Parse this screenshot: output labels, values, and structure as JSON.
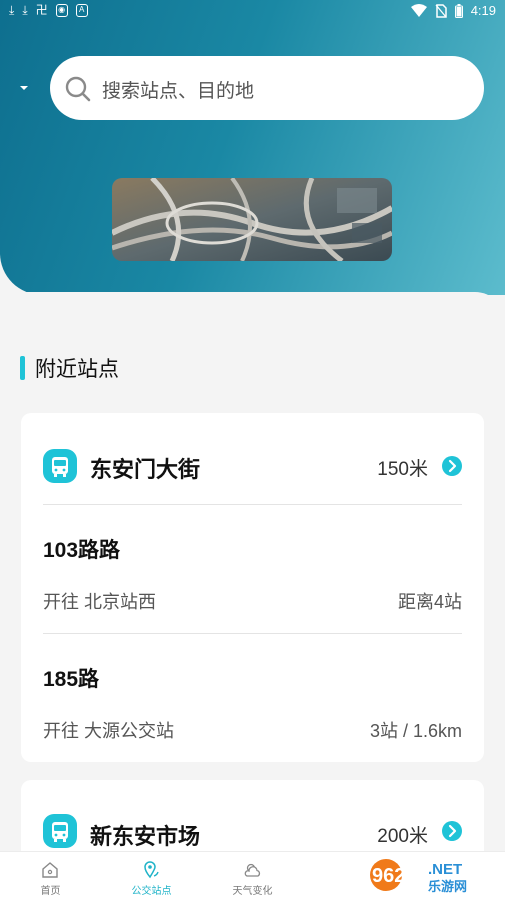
{
  "status_bar": {
    "time": "4:19",
    "left_icons": [
      "download-icon",
      "download-icon",
      "sim-icon",
      "vpn-icon",
      "a-icon"
    ],
    "right_icons": [
      "wifi-icon",
      "no-sim-icon",
      "battery-icon"
    ]
  },
  "search": {
    "placeholder": "搜索站点、目的地"
  },
  "section": {
    "title": "附近站点"
  },
  "stops": [
    {
      "name": "东安门大街",
      "distance": "150米",
      "routes": [
        {
          "name": "103路路",
          "direction": "开往 北京站西",
          "eta": "距离4站"
        },
        {
          "name": "185路",
          "direction": "开往 大源公交站",
          "eta": "3站 / 1.6km"
        }
      ]
    },
    {
      "name": "新东安市场",
      "distance": "200米",
      "routes": []
    }
  ],
  "tabs": [
    {
      "label": "首页",
      "icon": "home-icon",
      "active": false
    },
    {
      "label": "公交站点",
      "icon": "location-pin-icon",
      "active": true
    },
    {
      "label": "天气变化",
      "icon": "weather-icon",
      "active": false
    },
    {
      "label": "",
      "icon": "",
      "active": false
    },
    {
      "label": "",
      "icon": "",
      "active": false
    }
  ],
  "colors": {
    "accent": "#1fc3d7",
    "header_start": "#0e6f8f",
    "header_end": "#5cbccd",
    "background": "#f4f4f4"
  },
  "watermark": {
    "text": "962.NET",
    "sub": "乐游网"
  }
}
